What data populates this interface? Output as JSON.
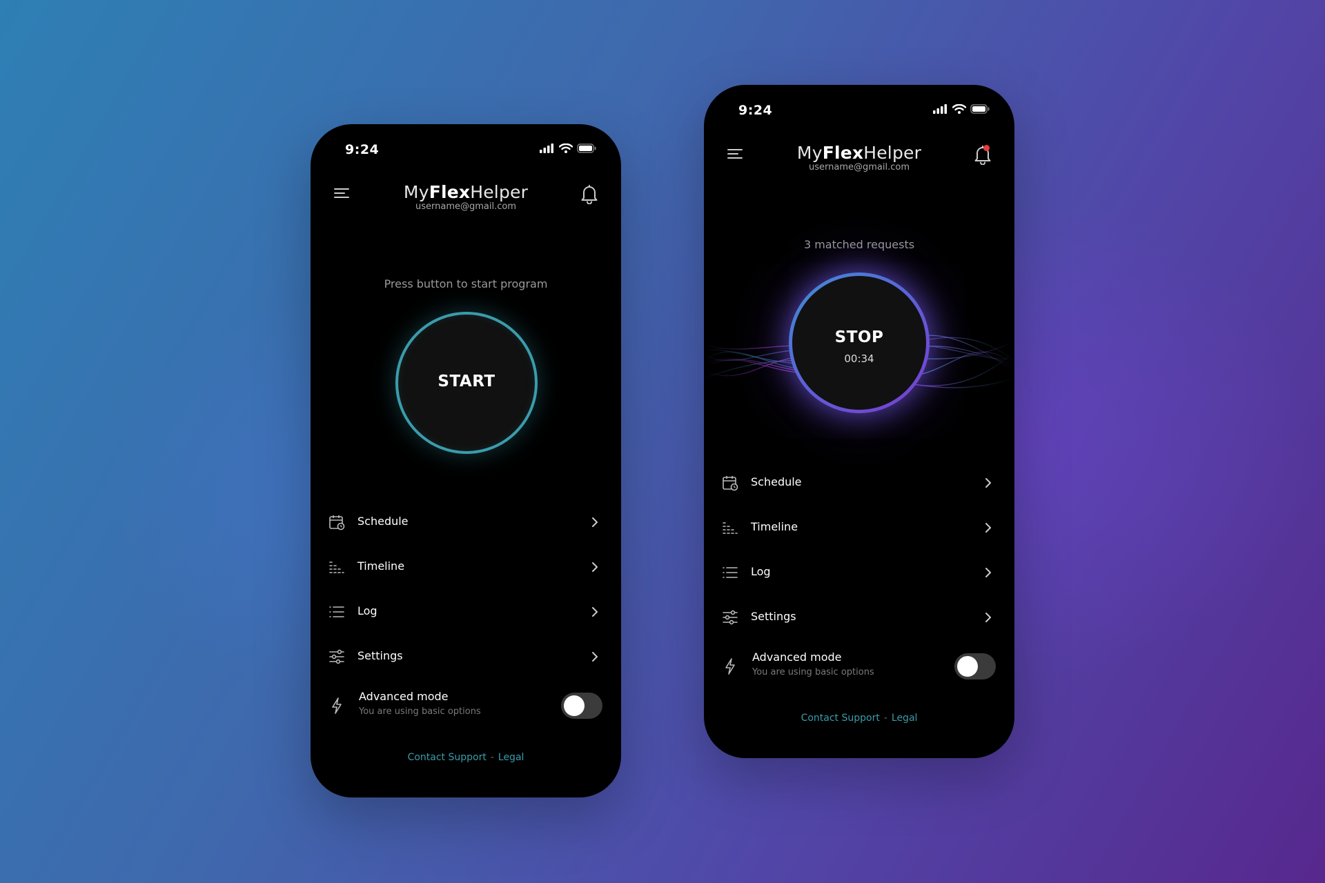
{
  "screens": [
    {
      "status": {
        "time": "9:24"
      },
      "brand": {
        "prefix": "My",
        "strong": "Flex",
        "suffix": "Helper"
      },
      "user": {
        "email": "username@gmail.com"
      },
      "prompt": "Press button to start program",
      "main_button": {
        "label": "START"
      },
      "menu": [
        {
          "label": "Schedule",
          "icon": "calendar-clock-icon"
        },
        {
          "label": "Timeline",
          "icon": "timeline-icon"
        },
        {
          "label": "Log",
          "icon": "list-icon"
        },
        {
          "label": "Settings",
          "icon": "sliders-icon"
        }
      ],
      "advanced": {
        "title": "Advanced mode",
        "subtitle": "You are using basic options",
        "enabled": false
      },
      "footer": {
        "contact": "Contact Support",
        "separator": "-",
        "legal": "Legal"
      },
      "notification_dot": false
    },
    {
      "status": {
        "time": "9:24"
      },
      "brand": {
        "prefix": "My",
        "strong": "Flex",
        "suffix": "Helper"
      },
      "user": {
        "email": "username@gmail.com"
      },
      "prompt": "3 matched requests",
      "main_button": {
        "label": "STOP",
        "timer": "00:34"
      },
      "menu": [
        {
          "label": "Schedule",
          "icon": "calendar-clock-icon"
        },
        {
          "label": "Timeline",
          "icon": "timeline-icon"
        },
        {
          "label": "Log",
          "icon": "list-icon"
        },
        {
          "label": "Settings",
          "icon": "sliders-icon"
        }
      ],
      "advanced": {
        "title": "Advanced mode",
        "subtitle": "You are using basic options",
        "enabled": false
      },
      "footer": {
        "contact": "Contact Support",
        "separator": "-",
        "legal": "Legal"
      },
      "notification_dot": true
    }
  ],
  "colors": {
    "accent_teal": "#3a9cab",
    "accent_purple": "#7b3bd1",
    "notification_red": "#ec3b3b",
    "phone_bg": "#000000"
  }
}
